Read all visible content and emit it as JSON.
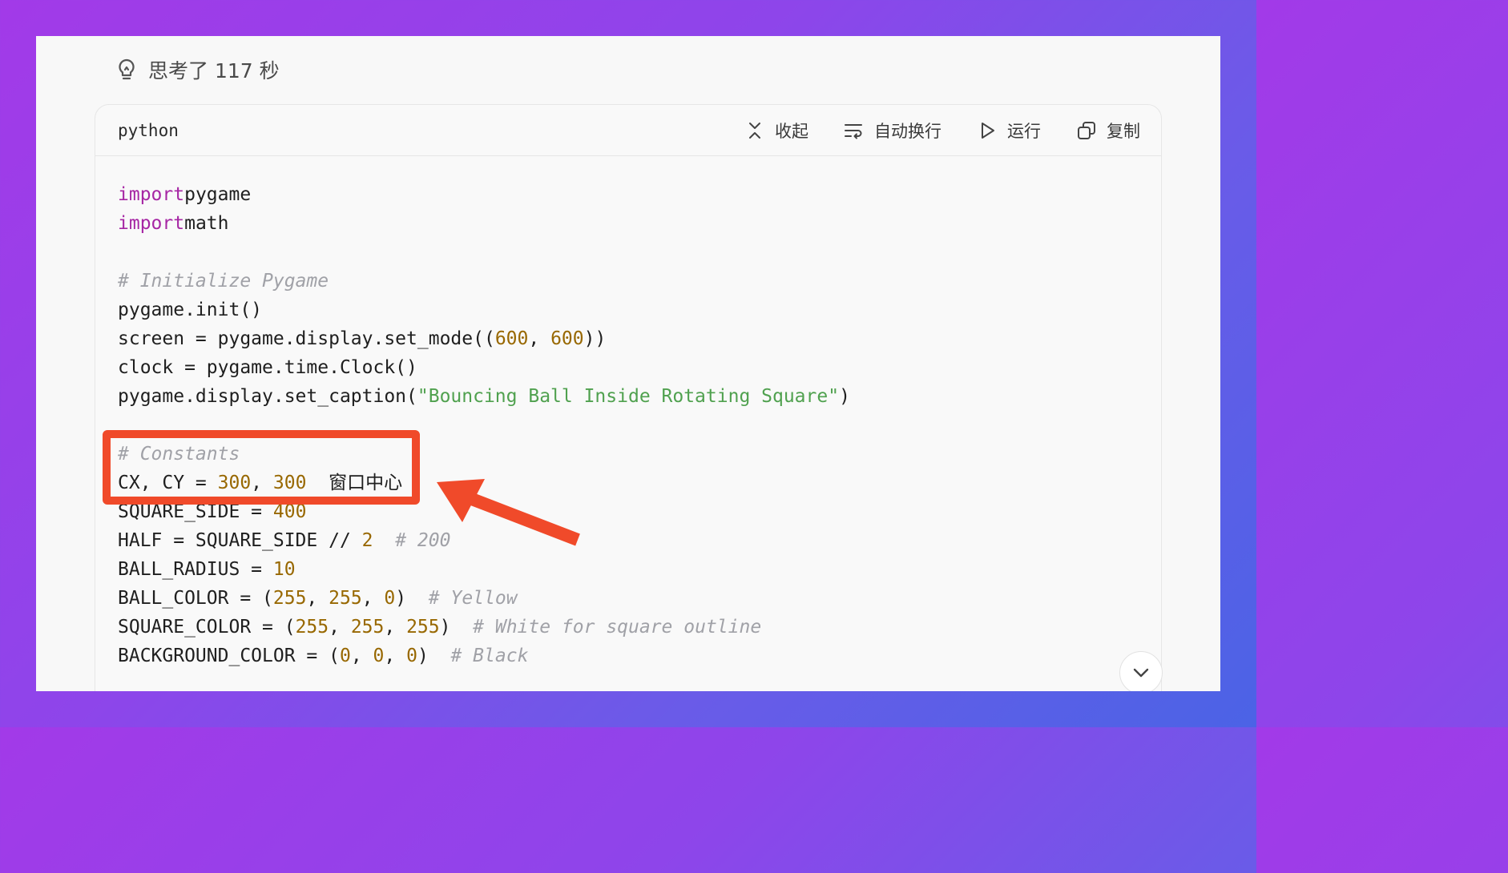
{
  "thinking": {
    "label": "思考了 117 秒",
    "icon": "lightbulb-icon"
  },
  "code_block": {
    "language": "python",
    "actions": [
      {
        "label": "收起",
        "icon": "collapse-icon"
      },
      {
        "label": "自动换行",
        "icon": "wrap-icon"
      },
      {
        "label": "运行",
        "icon": "play-icon"
      },
      {
        "label": "复制",
        "icon": "copy-icon"
      }
    ],
    "lines": [
      [
        [
          "kw",
          "import"
        ],
        [
          "",
          "pygame"
        ]
      ],
      [
        [
          "kw",
          "import"
        ],
        [
          "",
          "math"
        ]
      ],
      [],
      [
        [
          "cm",
          "# Initialize Pygame"
        ]
      ],
      [
        [
          "",
          "pygame.init()"
        ]
      ],
      [
        [
          "",
          "screen = pygame.display.set_mode(("
        ],
        [
          "num",
          "600"
        ],
        [
          "",
          ", "
        ],
        [
          "num",
          "600"
        ],
        [
          "",
          "))"
        ]
      ],
      [
        [
          "",
          "clock = pygame.time.Clock()"
        ]
      ],
      [
        [
          "",
          "pygame.display.set_caption("
        ],
        [
          "str",
          "\"Bouncing Ball Inside Rotating Square\""
        ],
        [
          "",
          ")"
        ]
      ],
      [],
      [
        [
          "cm",
          "# Constants"
        ]
      ],
      [
        [
          "",
          "CX, CY = "
        ],
        [
          "num",
          "300"
        ],
        [
          "",
          ", "
        ],
        [
          "num",
          "300"
        ],
        [
          "",
          "  窗口中心"
        ]
      ],
      [
        [
          "",
          "SQUARE_SIDE = "
        ],
        [
          "num",
          "400"
        ]
      ],
      [
        [
          "",
          "HALF = SQUARE_SIDE // "
        ],
        [
          "num",
          "2"
        ],
        [
          "",
          "  "
        ],
        [
          "cm",
          "# 200"
        ]
      ],
      [
        [
          "",
          "BALL_RADIUS = "
        ],
        [
          "num",
          "10"
        ]
      ],
      [
        [
          "",
          "BALL_COLOR = ("
        ],
        [
          "num",
          "255"
        ],
        [
          "",
          ", "
        ],
        [
          "num",
          "255"
        ],
        [
          "",
          ", "
        ],
        [
          "num",
          "0"
        ],
        [
          "",
          ")  "
        ],
        [
          "cm",
          "# Yellow"
        ]
      ],
      [
        [
          "",
          "SQUARE_COLOR = ("
        ],
        [
          "num",
          "255"
        ],
        [
          "",
          ", "
        ],
        [
          "num",
          "255"
        ],
        [
          "",
          ", "
        ],
        [
          "num",
          "255"
        ],
        [
          "",
          ")  "
        ],
        [
          "cm",
          "# White for square outline"
        ]
      ],
      [
        [
          "",
          "BACKGROUND_COLOR = ("
        ],
        [
          "num",
          "0"
        ],
        [
          "",
          ", "
        ],
        [
          "num",
          "0"
        ],
        [
          "",
          ", "
        ],
        [
          "num",
          "0"
        ],
        [
          "",
          ")  "
        ],
        [
          "cm",
          "# Black"
        ]
      ]
    ]
  },
  "annotation": {
    "color": "#f04a2a"
  },
  "scroll_button": {
    "icon": "chevron-down-icon"
  }
}
